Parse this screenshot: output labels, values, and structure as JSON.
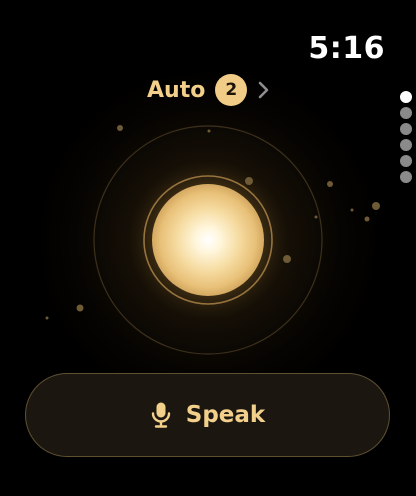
{
  "status_bar": {
    "time": "5:16"
  },
  "mode": {
    "label": "Auto",
    "badge": "2",
    "chevron_icon": "chevron-right-icon"
  },
  "page_indicator": {
    "count": 6,
    "active_index": 0
  },
  "orb": {
    "icon": "glowing-orb"
  },
  "speak_button": {
    "label": "Speak",
    "icon": "microphone-icon"
  },
  "colors": {
    "accent": "#f2cf8b",
    "badge_bg": "#f0cc86",
    "button_bg": "#1b1710",
    "button_border": "#5f4f33",
    "background": "#000000"
  }
}
